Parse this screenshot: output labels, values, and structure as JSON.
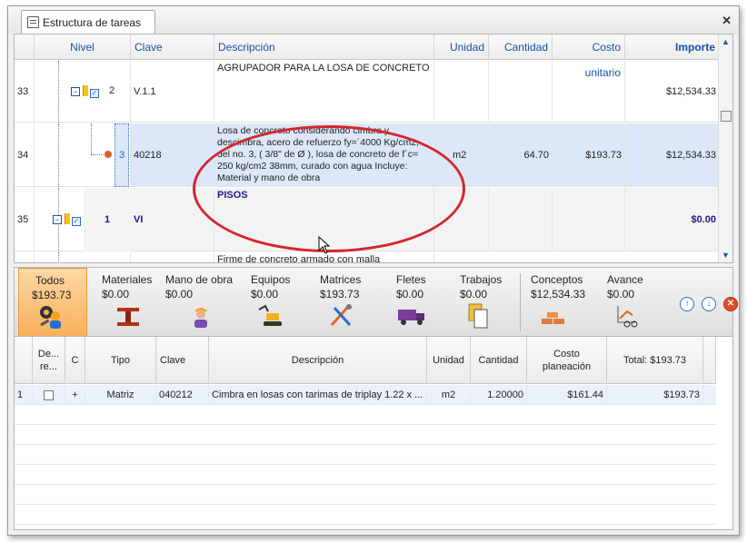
{
  "tab": {
    "title": "Estructura de tareas"
  },
  "upper": {
    "headers": {
      "nivel": "Nivel",
      "clave": "Clave",
      "descripcion": "Descripción",
      "unidad": "Unidad",
      "cantidad": "Cantidad",
      "costo_unitario": "Costo unitario",
      "importe": "Importe"
    },
    "rows": [
      {
        "num": "33",
        "level": "2",
        "clave": "V.1.1",
        "descripcion": "AGRUPADOR PARA LA LOSA DE CONCRETO",
        "unidad": "",
        "cantidad": "",
        "costo": "",
        "importe": "$12,534.33"
      },
      {
        "num": "34",
        "level": "3",
        "clave": "40218",
        "descripcion": "Losa de concreto considerando cimbra y descimbra, acero de refuerzo fy=´4000 Kg/cm2, del no. 3,  ( 3/8\" de Ø ), losa de concreto de f´c= 250 kg/cm2 38mm, curado con agua Incluye: Material y mano de obra",
        "unidad": "m2",
        "cantidad": "64.70",
        "costo": "$193.73",
        "importe": "$12,534.33"
      },
      {
        "num": "35",
        "level": "1",
        "clave": "VI",
        "descripcion": "PISOS",
        "unidad": "",
        "cantidad": "",
        "costo": "",
        "importe": "$0.00"
      },
      {
        "num": "",
        "level": "",
        "clave": "",
        "descripcion": "Firme de concreto armado con malla",
        "unidad": "",
        "cantidad": "",
        "costo": "",
        "importe": ""
      }
    ]
  },
  "toolbar": {
    "items": [
      {
        "label": "Todos",
        "value": "$193.73",
        "icon": "worker-tools-icon"
      },
      {
        "label": "Materiales",
        "value": "$0.00",
        "icon": "steel-beam-icon"
      },
      {
        "label": "Mano de obra",
        "value": "$0.00",
        "icon": "worker-icon"
      },
      {
        "label": "Equipos",
        "value": "$0.00",
        "icon": "excavator-icon"
      },
      {
        "label": "Matrices",
        "value": "$193.73",
        "icon": "tools-icon"
      },
      {
        "label": "Fletes",
        "value": "$0.00",
        "icon": "truck-icon"
      },
      {
        "label": "Trabajos",
        "value": "$0.00",
        "icon": "documents-icon"
      },
      {
        "label": "Conceptos",
        "value": "$12,534.33",
        "icon": "bricks-icon"
      },
      {
        "label": "Avance",
        "value": "$0.00",
        "icon": "progress-chart-icon"
      }
    ]
  },
  "lower": {
    "headers": {
      "de": "De... re...",
      "c": "C",
      "tipo": "Tipo",
      "clave": "Clave",
      "descripcion": "Descripción",
      "unidad": "Unidad",
      "cantidad": "Cantidad",
      "costo": "Costo planeación",
      "total": "Total: $193.73"
    },
    "rows": [
      {
        "num": "1",
        "c": "+",
        "tipo": "Matriz",
        "clave": "040212",
        "descripcion": "Cimbra en losas con tarimas de triplay 1.22 x ...",
        "unidad": "m2",
        "cantidad": "1.20000",
        "costo": "$161.44",
        "total": "$193.73"
      }
    ]
  }
}
